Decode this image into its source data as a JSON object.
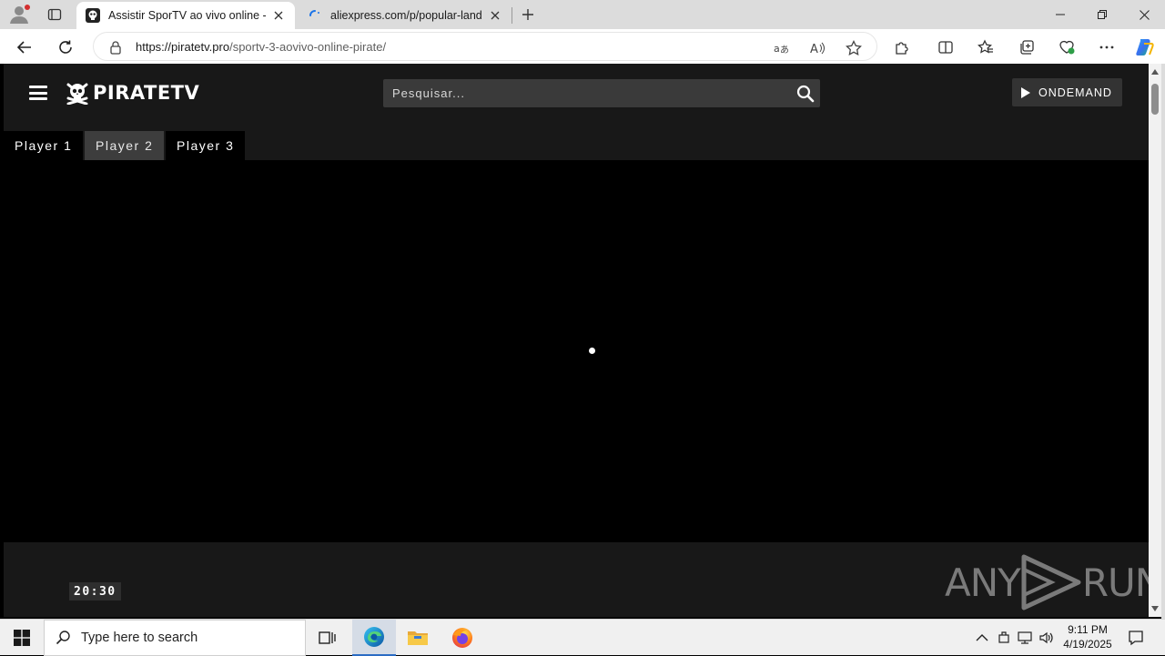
{
  "browser": {
    "tabs": [
      {
        "title": "Assistir SporTV ao vivo online - P",
        "active": true
      },
      {
        "title": "aliexpress.com/p/popular-landin",
        "active": false
      }
    ],
    "url_domain": "https://piratetv.pro",
    "url_path": "/sportv-3-aovivo-online-pirate/"
  },
  "site": {
    "logo_text_a": "PIRATE",
    "logo_text_b": "TV",
    "search_placeholder": "Pesquisar...",
    "ondemand_label": "ONDEMAND",
    "player_tabs": [
      {
        "label": "Player 1",
        "active": false
      },
      {
        "label": "Player 2",
        "active": true
      },
      {
        "label": "Player 3",
        "active": false
      }
    ],
    "clock_badge": "20:30",
    "watermark_a": "ANY",
    "watermark_b": "RUN"
  },
  "taskbar": {
    "search_text": "Type here to search",
    "time": "9:11 PM",
    "date": "4/19/2025"
  },
  "colors": {
    "header_bg": "#181818",
    "active_tab_bg": "#3d3d3d",
    "edge_accent": "#0f6cbd"
  }
}
